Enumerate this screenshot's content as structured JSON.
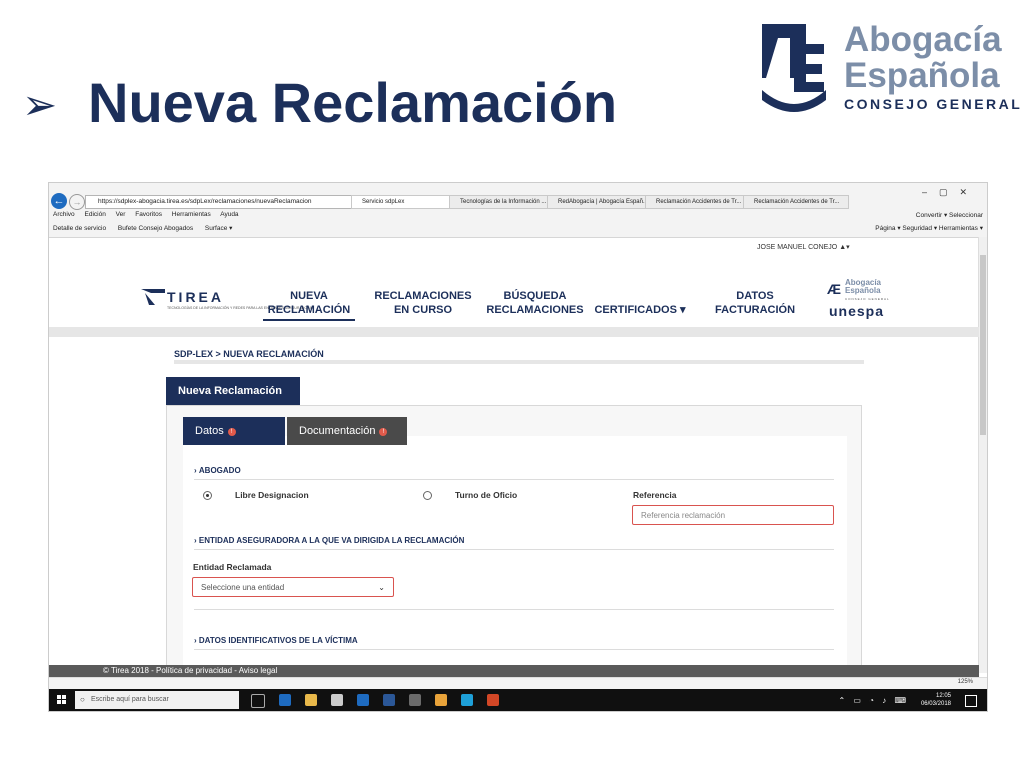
{
  "slide": {
    "title": "Nueva Reclamación",
    "bullet": "➢",
    "logo": {
      "line1": "Abogacía",
      "line2": "Española",
      "line3": "CONSEJO GENERAL"
    }
  },
  "browser": {
    "address": "https://sdplex-abogacia.tirea.es/sdpLex/reclamaciones/nuevaReclamacion",
    "tabs": [
      "Servicio sdpLex",
      "Tecnologías de la Información ...",
      "RedAbogacía | Abogacía Españ...",
      "Reclamación Accidentes de Tr...",
      "Reclamación Accidentes de Tr..."
    ],
    "menu": [
      "Archivo",
      "Edición",
      "Ver",
      "Favoritos",
      "Herramientas",
      "Ayuda"
    ],
    "favorites": [
      "Detalle de servicio",
      "Bufete Consejo Abogados",
      "Surface ▾"
    ],
    "right_menu": "Convertir  ▾   Seleccionar",
    "right_tools": "Página ▾   Seguridad ▾   Herramientas ▾",
    "zoom": "125%"
  },
  "page": {
    "user": "JOSE MANUEL CONEJO",
    "brand": "TIREA",
    "brand_sub": "TECNOLOGÍAS DE LA INFORMACIÓN Y REDES PARA LAS ENTIDADES ASEGURADORAS",
    "nav": [
      {
        "line1": "NUEVA",
        "line2": "RECLAMACIÓN"
      },
      {
        "line1": "RECLAMACIONES",
        "line2": "EN CURSO"
      },
      {
        "line1": "BÚSQUEDA",
        "line2": "RECLAMACIONES"
      },
      {
        "line1": "CERTIFICADOS ▾",
        "line2": ""
      },
      {
        "line1": "DATOS",
        "line2": "FACTURACIÓN"
      }
    ],
    "mini_logo": {
      "line1": "Abogacía",
      "line2": "Española",
      "line3": "CONSEJO GENERAL",
      "unespa": "unespa"
    },
    "breadcrumb": "SDP-LEX > NUEVA RECLAMACIÓN",
    "panel_title": "Nueva Reclamación",
    "tabs": [
      {
        "label": "Datos",
        "alert": "!"
      },
      {
        "label": "Documentación",
        "alert": "!"
      }
    ],
    "sections": {
      "abogado": "ABOGADO",
      "entidad": "ENTIDAD ASEGURADORA A LA QUE VA DIRIGIDA LA RECLAMACIÓN",
      "victima": "DATOS IDENTIFICATIVOS DE LA VÍCTIMA"
    },
    "form": {
      "radio_libre": "Libre Designacion",
      "radio_turno": "Turno de Oficio",
      "referencia_label": "Referencia",
      "referencia_placeholder": "Referencia reclamación",
      "entidad_label": "Entidad Reclamada",
      "entidad_placeholder": "Seleccione una entidad"
    },
    "footer": "© Tirea 2018 - Política de privacidad - Aviso legal"
  },
  "taskbar": {
    "search_placeholder": "Escribe aquí para buscar",
    "time": "12:05",
    "date": "06/03/2018"
  },
  "colors": {
    "brand": "#1c2f5a",
    "brand_light": "#7c8ea8",
    "alert": "#e05a4b",
    "field_border": "#d9534f"
  }
}
